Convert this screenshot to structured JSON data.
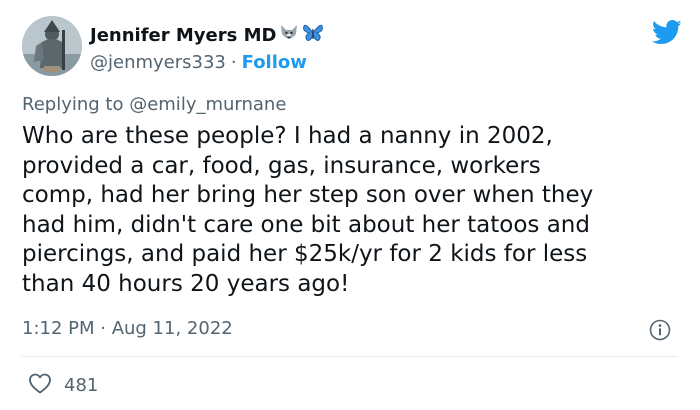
{
  "tweet": {
    "author": {
      "display_name": "Jennifer Myers MD",
      "emoji": [
        "wolf-emoji",
        "butterfly-emoji"
      ],
      "handle": "@jenmyers333",
      "separator": "·",
      "follow_label": "Follow"
    },
    "reply": {
      "prefix": "Replying to ",
      "mention": "@emily_murnane"
    },
    "text": "Who are these people? I had a nanny in 2002,\nprovided a car, food, gas, insurance, workers\ncomp, had her bring her step son over when they\nhad him, didn't care one bit about her tatoos and\npiercings, and paid her $25k/yr for 2 kids for less\nthan 40 hours 20 years ago!",
    "timestamp": "1:12 PM · Aug 11, 2022",
    "likes": "481",
    "icons": [
      "twitter-bird-icon",
      "info-icon",
      "heart-icon"
    ],
    "colors": {
      "accent": "#1d9bf0",
      "secondary_text": "#536471",
      "primary_text": "#0f1419",
      "divider": "#e6ecf0"
    }
  }
}
